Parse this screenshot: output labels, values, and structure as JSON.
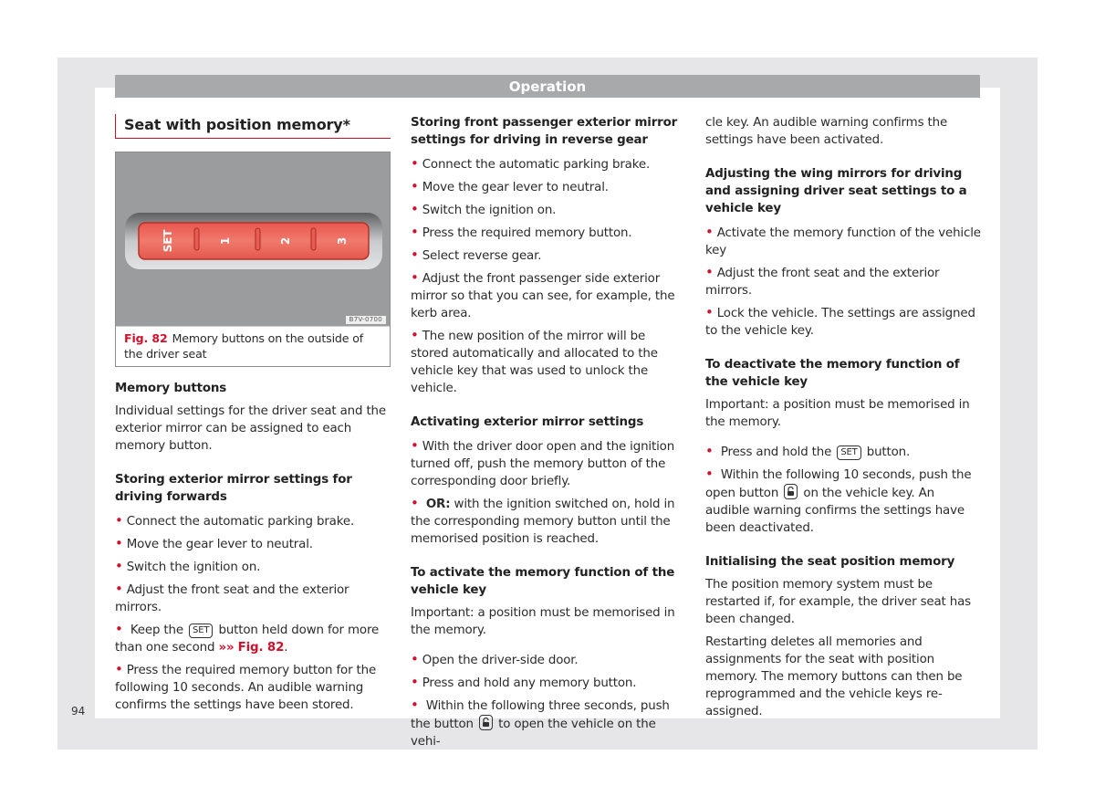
{
  "header": {
    "title": "Operation"
  },
  "page_number": "94",
  "colors": {
    "accent": "#d1102c",
    "header_bar": "#a8a9ab",
    "frame": "#e6e6e8"
  },
  "col1": {
    "section_title": "Seat with position memory*",
    "figure": {
      "buttons": [
        "SET",
        "1",
        "2",
        "3"
      ],
      "code": "B7V-0700",
      "label": "Fig. 82",
      "caption": "Memory buttons on the outside of the driver seat"
    },
    "memory_heading": "Memory buttons",
    "memory_text": "Individual settings for the driver seat and the exterior mirror can be assigned to each memory button.",
    "forward_heading": "Storing exterior mirror settings for driving forwards",
    "forward_bullets": [
      "Connect the automatic parking brake.",
      "Move the gear lever to neutral.",
      "Switch the ignition on.",
      "Adjust the front seat and the exterior mirrors."
    ],
    "keep_pre": "Keep the",
    "keep_key": "SET",
    "keep_post": "button held down for more than one second",
    "keep_arrow": "»»",
    "keep_ref": "Fig. 82",
    "press_bullet": "Press the required memory button for the following 10 seconds. An audible warning confirms the settings have been stored."
  },
  "col2": {
    "reverse_heading": "Storing front passenger exterior mirror settings for driving in reverse gear",
    "reverse_bullets": [
      "Connect the automatic parking brake.",
      "Move the gear lever to neutral.",
      "Switch the ignition on.",
      "Press the required memory button.",
      "Select reverse gear.",
      "Adjust the front passenger side exterior mirror so that you can see, for example, the kerb area.",
      "The new position of the mirror will be stored automatically and allocated to the vehicle key that was used to unlock the vehicle."
    ],
    "activating_heading": "Activating exterior mirror settings",
    "activating_bullet1": "With the driver door open and the ignition turned off, push the memory button of the corresponding door briefly.",
    "activating_or": "OR:",
    "activating_bullet2": "with the ignition switched on, hold in the corresponding memory button until the memorised position is reached.",
    "activate_key_heading": "To activate the memory function of the vehicle key",
    "activate_key_text": "Important: a position must be memorised in the memory.",
    "activate_key_bullets": [
      "Open the driver-side door.",
      "Press and hold any memory button."
    ],
    "within_pre": "Within the following three seconds, push the button",
    "within_post": "to open the vehicle on the vehi-"
  },
  "col3": {
    "continued_text": "cle key. An audible warning confirms the settings have been activated.",
    "wing_heading": "Adjusting the wing mirrors for driving and assigning driver seat settings to a vehicle key",
    "wing_bullets": [
      "Activate the memory function of the vehicle key",
      "Adjust the front seat and the exterior mirrors.",
      "Lock the vehicle. The settings are assigned to the vehicle key."
    ],
    "deactivate_heading": "To deactivate the memory function of the vehicle key",
    "deactivate_text": "Important: a position must be memorised in the memory.",
    "hold_pre": "Press and hold the",
    "hold_key": "SET",
    "hold_post": "button.",
    "within_pre": "Within the following 10 seconds, push the open button",
    "within_post": "on the vehicle key. An audible warning confirms the settings have been deactivated.",
    "init_heading": "Initialising the seat position memory",
    "init_text1": "The position memory system must be restarted if, for example, the driver seat has been changed.",
    "init_text2": "Restarting deletes all memories and assignments for the seat with position memory. The memory buttons can then be reprogrammed and the vehicle keys re-assigned."
  }
}
